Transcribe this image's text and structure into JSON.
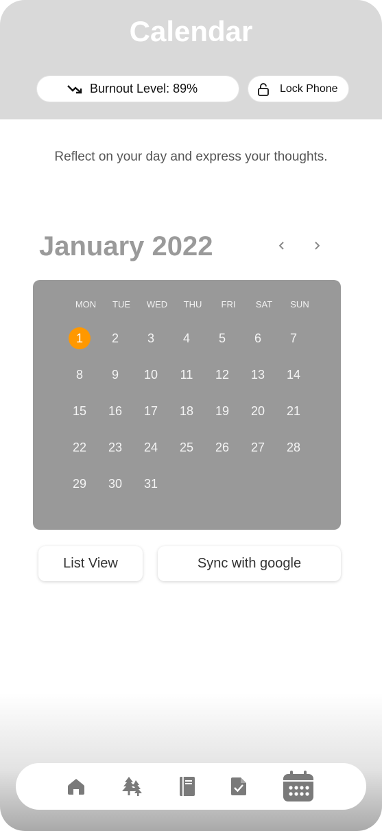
{
  "header": {
    "title": "Calendar",
    "burnout_label": "Burnout Level: 89%",
    "lock_label": "Lock Phone"
  },
  "subtitle": "Reflect on your day and express your thoughts.",
  "calendar": {
    "month_label": "January 2022",
    "weekdays": [
      "MON",
      "TUE",
      "WED",
      "THU",
      "FRI",
      "SAT",
      "SUN"
    ],
    "days": [
      [
        "1",
        "2",
        "3",
        "4",
        "5",
        "6",
        "7"
      ],
      [
        "8",
        "9",
        "10",
        "11",
        "12",
        "13",
        "14"
      ],
      [
        "15",
        "16",
        "17",
        "18",
        "19",
        "20",
        "21"
      ],
      [
        "22",
        "23",
        "24",
        "25",
        "26",
        "27",
        "28"
      ],
      [
        "29",
        "30",
        "31"
      ]
    ],
    "selected_day": "1"
  },
  "buttons": {
    "list_view": "List View",
    "sync": "Sync with google"
  },
  "tabs": [
    {
      "icon": "home-icon"
    },
    {
      "icon": "trees-icon"
    },
    {
      "icon": "journal-icon"
    },
    {
      "icon": "checklist-icon"
    },
    {
      "icon": "calendar-icon",
      "active": true
    }
  ],
  "colors": {
    "header_bg": "#d9d9d9",
    "calendar_bg": "#999999",
    "accent": "#ff9800",
    "icon_gray": "#7a7a7a"
  }
}
